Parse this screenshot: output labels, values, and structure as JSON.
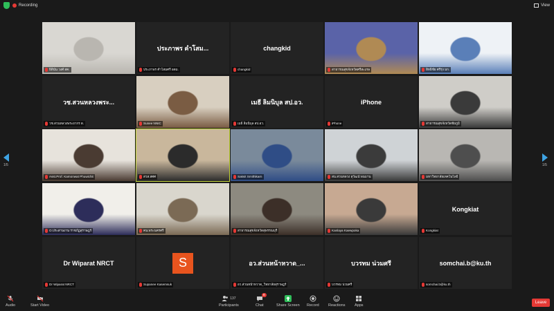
{
  "topbar": {
    "recording_label": "Recording",
    "view_label": "View"
  },
  "pager": {
    "left_indicator": "1/5",
    "right_indicator": "1/5"
  },
  "tiles": [
    {
      "name": "",
      "label": "ธิตินัน วงศ์ สค.",
      "type": "video",
      "palette": [
        "#d9d7d2",
        "#b9b6b0"
      ]
    },
    {
      "name": "ประภาพร คำโสม...",
      "label": "ประภาพร คำโสมศรี อดม.",
      "type": "name"
    },
    {
      "name": "changkid",
      "label": "changkid",
      "type": "name"
    },
    {
      "name": "",
      "label": "สาธารณสุขจังหวัดศรีสะเกษ",
      "type": "video",
      "palette": [
        "#5a63a8",
        "#b08a54"
      ]
    },
    {
      "name": "",
      "label": "สิทธิชัย ศรีรุ่ง มก.",
      "type": "video",
      "palette": [
        "#eef2f6",
        "#5a7fb8"
      ]
    },
    {
      "name": "วช.สวนหลวงพระ...",
      "label": "วช.สวนหลวงพระยากร ต.",
      "type": "name"
    },
    {
      "name": "",
      "label": "Sunee NNIC",
      "type": "video",
      "palette": [
        "#d8cfc0",
        "#7a5c43"
      ]
    },
    {
      "name": "เมธี ลิมนิบุล สป.อว.",
      "label": "เมธี ลิมนิบุล สป.อว.",
      "type": "name"
    },
    {
      "name": "iPhone",
      "label": "iPhone",
      "type": "name"
    },
    {
      "name": "",
      "label": "สาธารณสุขจังหวัดชัยภูมิ",
      "type": "video",
      "palette": [
        "#cfcdc8",
        "#3a3a3a"
      ]
    },
    {
      "name": "",
      "label": "Asst.Prof. Kamonwat Phuwichit",
      "type": "video",
      "palette": [
        "#e7e3dc",
        "#4a3b32"
      ]
    },
    {
      "name": "",
      "label": "สวส.สศศ",
      "type": "video",
      "palette": [
        "#c9b79c",
        "#2b2b2b"
      ],
      "active": true
    },
    {
      "name": "",
      "label": "Saksit Smithikarn",
      "type": "video",
      "palette": [
        "#7a8a9b",
        "#2f4d86"
      ]
    },
    {
      "name": "",
      "label": "สน.สวนหลวง สุวัฒน์ พนมาน",
      "type": "video",
      "palette": [
        "#cfd3d6",
        "#3b3b3b"
      ]
    },
    {
      "name": "",
      "label": "มหาวิทยาลัยเทคโนโลยี",
      "type": "video",
      "palette": [
        "#b9b7b3",
        "#4e4e4e"
      ]
    },
    {
      "name": "",
      "label": "O.ประสานงาน ราชภัฏสุราษฎร์",
      "type": "video",
      "palette": [
        "#f1efea",
        "#2d2d5a"
      ]
    },
    {
      "name": "",
      "label": "คน.พระนครศรี",
      "type": "video",
      "palette": [
        "#d9d6cd",
        "#7b6a55"
      ]
    },
    {
      "name": "",
      "label": "สาธารณสุขจังหวัดสุพรรณบุรี",
      "type": "video",
      "palette": [
        "#8d8a80",
        "#3c2f28"
      ]
    },
    {
      "name": "",
      "label": "Kanlaya Kaewpoka",
      "type": "video",
      "palette": [
        "#c7a992",
        "#3a3a3a"
      ]
    },
    {
      "name": "Kongkiat",
      "label": "Kongkiat",
      "type": "name"
    },
    {
      "name": "Dr Wiparat NRCT",
      "label": "Dr Wiparat NRCT",
      "type": "name"
    },
    {
      "name": "",
      "label": "Supanee Kasemsuk",
      "type": "avatar",
      "initial": "S"
    },
    {
      "name": "อว.ส่วนหน้าหวาด_...",
      "label": "อว.ส่วนหน้าหวาด_วิทยาลัยสุราษฎร์",
      "type": "name"
    },
    {
      "name": "บวรทม น่วมศรี",
      "label": "บวรทม น่วมศรี",
      "type": "name"
    },
    {
      "name": "somchai.b@ku.th",
      "label": "somchai.b@ku.th",
      "type": "name"
    }
  ],
  "toolbar": {
    "audio": "Audio",
    "start_video": "Start Video",
    "participants": "Participants",
    "participants_count": "137",
    "chat": "Chat",
    "chat_badge": "8",
    "share_screen": "Share Screen",
    "record": "Record",
    "reactions": "Reactions",
    "apps": "Apps",
    "leave": "Leave"
  },
  "colors": {
    "accent": "#3ea3e3",
    "share": "#2fbe5a",
    "leave": "#e53935",
    "active_speaker": "#c4d63a",
    "avatar": "#e8541e"
  }
}
